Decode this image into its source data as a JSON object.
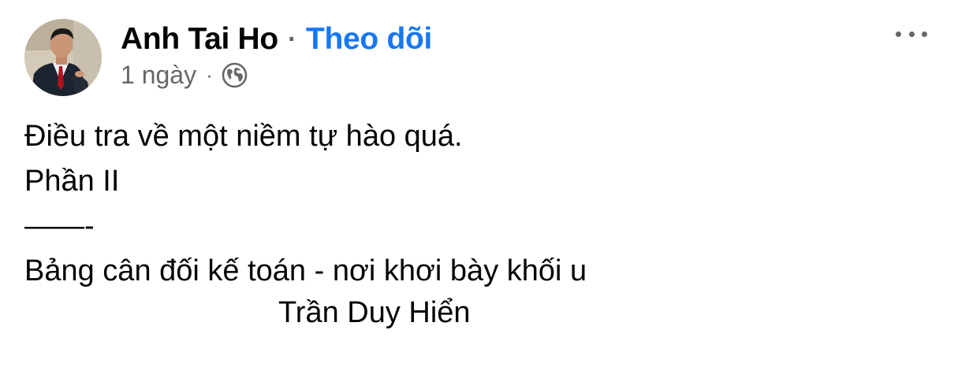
{
  "post": {
    "author": {
      "name": "Anh Tai Ho",
      "separator": "·",
      "follow_label": "Theo dõi",
      "avatar_icon": "profile-photo"
    },
    "meta": {
      "time": "1 ngày",
      "separator": "·",
      "privacy_icon": "globe-icon"
    },
    "menu_icon": "more-options-icon",
    "body": {
      "lines": [
        "Điều tra về một niềm tự hào quá.",
        "Phần II",
        "——-",
        "Bảng cân đối kế toán - nơi khơi bày khối u",
        "Trần Duy Hiển"
      ]
    },
    "colors": {
      "link": "#1877f2",
      "secondary_text": "#65676b",
      "primary_text": "#050505"
    }
  }
}
